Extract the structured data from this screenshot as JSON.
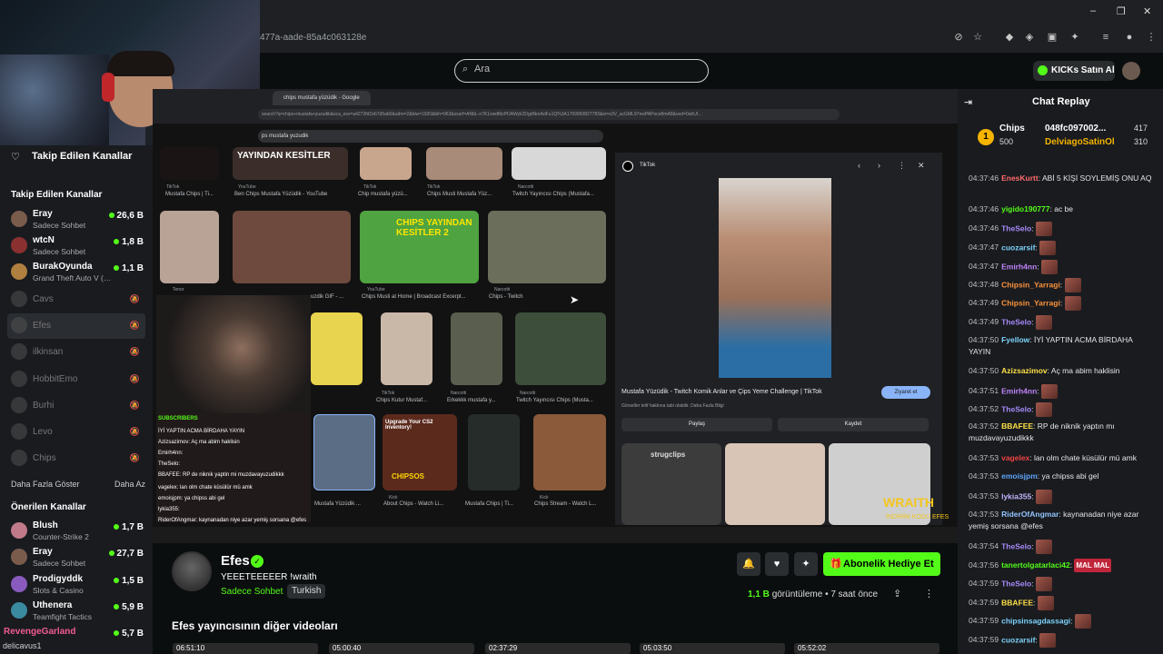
{
  "browser": {
    "url_fragment": "477a-aade-85a4c063128e",
    "window_controls": [
      "–",
      "❐",
      "✕"
    ]
  },
  "topnav": {
    "search_placeholder": "Ara",
    "kicks_button": "KICKs Satın Al"
  },
  "sidebar": {
    "header": "Takip Edilen Kanallar",
    "followed_title": "Takip Edilen Kanallar",
    "followed": [
      {
        "name": "Eray",
        "sub": "Sadece Sohbet",
        "count": "26,6 B",
        "live": true
      },
      {
        "name": "wtcN",
        "sub": "Sadece Sohbet",
        "count": "1,8 B",
        "live": true
      },
      {
        "name": "BurakOyunda",
        "sub": "Grand Theft Auto V (…",
        "count": "1,1 B",
        "live": true
      },
      {
        "name": "Cavs",
        "live": false
      },
      {
        "name": "Efes",
        "live": false
      },
      {
        "name": "ilkinsan",
        "live": false
      },
      {
        "name": "HobbitEmo",
        "live": false
      },
      {
        "name": "Burhi",
        "live": false
      },
      {
        "name": "Levo",
        "live": false
      },
      {
        "name": "Chips",
        "live": false
      }
    ],
    "show_more": "Daha Fazla Göster",
    "show_less": "Daha Az",
    "recommended_title": "Önerilen Kanallar",
    "recommended": [
      {
        "name": "Blush",
        "sub": "Counter-Strike 2",
        "count": "1,7 B"
      },
      {
        "name": "Eray",
        "sub": "Sadece Sohbet",
        "count": "27,7 B"
      },
      {
        "name": "Prodigyddk",
        "sub": "Slots & Casino",
        "count": "1,5 B"
      },
      {
        "name": "Uthenera",
        "sub": "Teamfight Tactics",
        "count": "5,9 B"
      },
      {
        "name": "RevengeGarland",
        "sub": "",
        "count": "5,7 B"
      }
    ],
    "footer_user": "delicavus1"
  },
  "video": {
    "inner_tab": "chips mustafa yüzüdik - Google",
    "inner_url": "search?q=chips+mustafa+yuzudik&sca_esv=a4272fd1b67d5ab0&udm=2&biw=1920&bih=963&sxsrf=ANbL-n7K1vwdMzPfJAWyk2DgdNorAdFu1Q%3A1769960827783&ei=e3V_acGML97ewPAPoce8mA8&ved=0ahUI…",
    "inner_search": "ps mustafa yuzudik",
    "thumbs": [
      {
        "src": "TikTok",
        "label": "Mustafa Chips | Ti..."
      },
      {
        "src": "YouTube",
        "label": "Ben Chips Mustafa Yüzüdik - YouTube"
      },
      {
        "src": "TikTok",
        "label": "Chip mustafa yüzü..."
      },
      {
        "src": "TikTok",
        "label": "Chips Musti Mustafa Yüz..."
      },
      {
        "src": "Narcotti",
        "label": "Twitch Yayıncısı Chips (Mustafa..."
      },
      {
        "src": "Tenor",
        "label": "uzdik GIF - ..."
      },
      {
        "src": "YouTube",
        "label": "Chips Musti at Home | Broadcast Excerpt..."
      },
      {
        "src": "Narcotti",
        "label": "Chips - Twitch"
      },
      {
        "src": "TikTok",
        "label": "Chips Kutur Mustaf..."
      },
      {
        "src": "Narcotti",
        "label": "Erkekkk mustafa y..."
      },
      {
        "src": "Narcotti",
        "label": "Twitch Yayıncısı Chips (Musta..."
      },
      {
        "src": "TikTok",
        "label": "Mustafa Yüzüdik ..."
      },
      {
        "src": "Kick",
        "label": "About Chips - Watch Li..."
      },
      {
        "src": "TikTok",
        "label": "Mustafa Chips | Ti..."
      },
      {
        "src": "Kick",
        "label": "Chips Stream - Watch L..."
      }
    ],
    "thumb_overlay_1": "YAYINDAN KESİTLER",
    "thumb_overlay_2": "CHIPS YAYINDAN KESİTLER 2",
    "thumb_overlay_3": "Upgrade Your CS2 Inventory!",
    "thumb_overlay_4": "CHIPSOS",
    "tiktok": {
      "brand": "TikTok",
      "title": "Mustafa Yüzüdik - Twitch Komik Anlar ve Çips Yeme Challenge | TikTok",
      "sub": "Görseller telif hakkına tabi olabilir.  Daha Fazla Bilgi",
      "visit": "Ziyaret et",
      "share": "Paylaş",
      "save": "Kaydet",
      "strip_label": "strugclips"
    },
    "overlay_chat_header": "SUBSCRIBERS",
    "overlay_chat": [
      "İYİ YAPTIN ACMA BİRDAHA YAYIN",
      "Azizsazimov: Aç ma abim haklisin",
      "Emirh4nn:",
      "TheSelo:",
      "BBAFEE: RP de niknik yaptin mi muzdavayuzudikkk",
      "vagelex: lan olm chate küsülür mü amk",
      "emoisjpm: ya chipss abi gel",
      "lykia355:",
      "RiderOfAngmar: kaynanadan niye azar yemiş sorsana @efes"
    ],
    "wraith_1": "WRAITH",
    "wraith_2": "İNDİRİM KODU EFES"
  },
  "channel": {
    "name": "Efes",
    "title": "YEEETEEEEER  !wraith",
    "category": "Sadece Sohbet",
    "tag": "Turkish",
    "gift_button": "Abonelik Hediye Et",
    "views_count": "1,1 B",
    "views_label": "görüntüleme",
    "time_ago": "• 7 saat önce",
    "other_videos_title": "Efes yayıncısının diğer videoları",
    "mini_thumbs": [
      "06:51:10",
      "05:00:40",
      "02:37:29",
      "05:03:50",
      "05:52:02"
    ]
  },
  "chat": {
    "title": "Chat Replay",
    "chips": {
      "name": "Chips",
      "amount": "500",
      "gift_id": "048fc097002...",
      "gift_count": "417",
      "donor": "DelviagoSatinOl",
      "donor_count": "310"
    },
    "messages": [
      {
        "t": "04:37:46",
        "user": "EnesKurtt",
        "color": "#ff6b6b",
        "text": "ABİ 5 KİŞİ SOYLEMİŞ ONU AQ"
      },
      {
        "t": "04:37:46",
        "user": "yigido190777",
        "color": "#53fc18",
        "text": "ac be"
      },
      {
        "t": "04:37:46",
        "user": "TheSelo",
        "color": "#a78bfa",
        "emote": true
      },
      {
        "t": "04:37:47",
        "user": "cuozarsif",
        "color": "#7dd3fc",
        "emote": true
      },
      {
        "t": "04:37:47",
        "user": "Emirh4nn",
        "color": "#c084fc",
        "emote": true
      },
      {
        "t": "04:37:48",
        "user": "Chipsin_Yarragi",
        "color": "#fb923c",
        "emote": true
      },
      {
        "t": "04:37:49",
        "user": "Chipsin_Yarragi",
        "color": "#fb923c",
        "emote": true
      },
      {
        "t": "04:37:49",
        "user": "TheSelo",
        "color": "#a78bfa",
        "emote": true
      },
      {
        "t": "04:37:50",
        "user": "Fyellow",
        "color": "#7dd3fc",
        "text": "İYİ YAPTIN ACMA BİRDAHA YAYIN"
      },
      {
        "t": "04:37:50",
        "user": "Azizsazimov",
        "color": "#fde047",
        "text": "Aç ma abim haklisin"
      },
      {
        "t": "04:37:51",
        "user": "Emirh4nn",
        "color": "#c084fc",
        "emote": true
      },
      {
        "t": "04:37:52",
        "user": "TheSelo",
        "color": "#a78bfa",
        "emote": true
      },
      {
        "t": "04:37:52",
        "user": "BBAFEE",
        "color": "#fde047",
        "text": "RP de niknik yaptın mı muzdavayuzudikkk"
      },
      {
        "t": "04:37:53",
        "user": "vagelex",
        "color": "#ef4444",
        "text": "lan olm chate küsülür mü amk"
      },
      {
        "t": "04:37:53",
        "user": "emoisjpm",
        "color": "#60a5fa",
        "text": "ya chipss abi gel"
      },
      {
        "t": "04:37:53",
        "user": "lykia355",
        "color": "#c4b5fd",
        "emote": true
      },
      {
        "t": "04:37:53",
        "user": "RiderOfAngmar",
        "color": "#93c5fd",
        "text": "kaynanadan niye azar yemiş sorsana @efes"
      },
      {
        "t": "04:37:54",
        "user": "TheSelo",
        "color": "#a78bfa",
        "emote": true
      },
      {
        "t": "04:37:56",
        "user": "tanertolgatarlaci42",
        "color": "#53fc18",
        "mal": "MAL MAL"
      },
      {
        "t": "04:37:59",
        "user": "TheSelo",
        "color": "#a78bfa",
        "emote": true
      },
      {
        "t": "04:37:59",
        "user": "BBAFEE",
        "color": "#fde047",
        "emote": true
      },
      {
        "t": "04:37:59",
        "user": "chipsinsagdassagi",
        "color": "#7dd3fc",
        "emote": true
      },
      {
        "t": "04:37:59",
        "user": "cuozarsif",
        "color": "#7dd3fc",
        "emote": true
      }
    ]
  },
  "colors": {
    "accent": "#53fc18",
    "bg": "#0b0e0f",
    "panel": "#191b1f"
  }
}
